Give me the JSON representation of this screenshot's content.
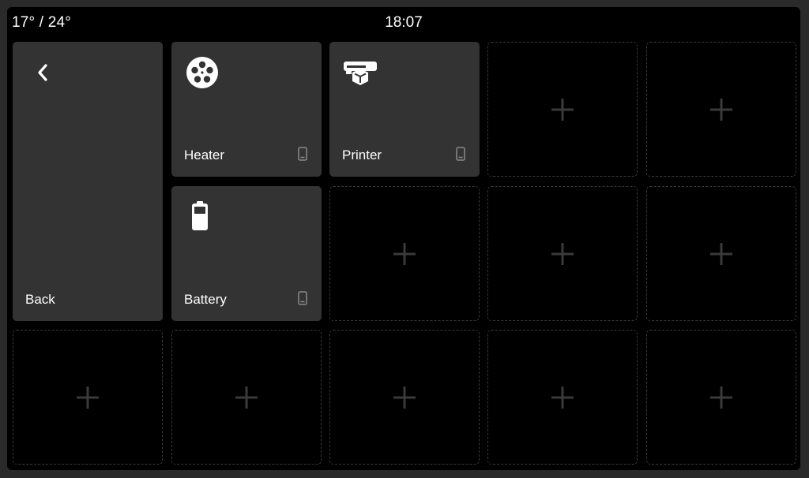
{
  "status": {
    "temperature": "17° / 24°",
    "time": "18:07"
  },
  "tiles": {
    "back": {
      "label": "Back",
      "icon": "chevron-left-icon"
    },
    "heater": {
      "label": "Heater",
      "icon": "film-reel-icon"
    },
    "printer": {
      "label": "Printer",
      "icon": "printer-3d-icon"
    },
    "battery": {
      "label": "Battery",
      "icon": "battery-icon"
    }
  },
  "empty_slot_icon": "plus-icon",
  "device_indicator_icon": "phone-icon",
  "colors": {
    "background": "#000000",
    "tile": "#333333",
    "text": "#ffffff",
    "muted": "#8a8a8a",
    "placeholder": "#3a3a3a"
  }
}
